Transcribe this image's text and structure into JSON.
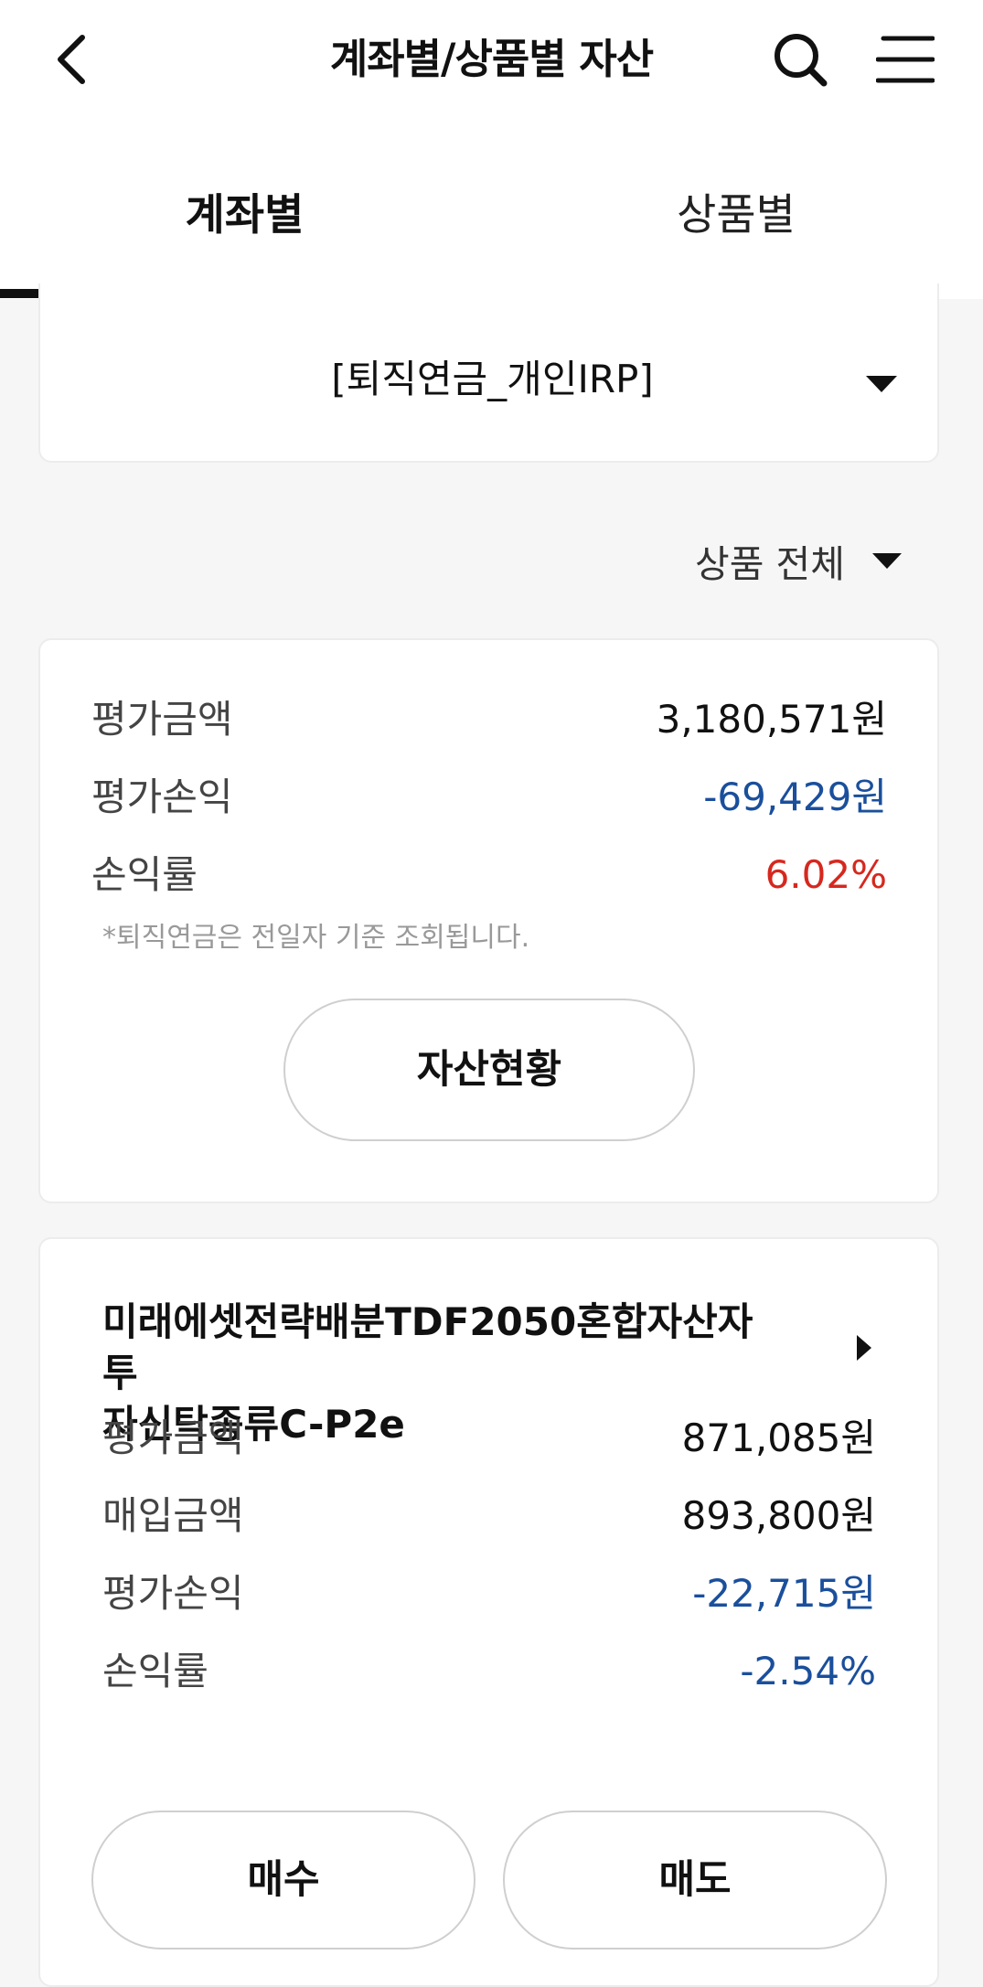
{
  "header": {
    "title": "계좌별/상품별 자산"
  },
  "tabs": [
    {
      "label": "계좌별",
      "active": true
    },
    {
      "label": "상품별",
      "active": false
    }
  ],
  "account": {
    "selected": "[퇴직연금_개인IRP]"
  },
  "filter": {
    "selected": "상품 전체"
  },
  "summary": {
    "rows": [
      {
        "label": "평가금액",
        "value": "3,180,571원"
      },
      {
        "label": "평가손익",
        "value": "-69,429원"
      },
      {
        "label": "손익률",
        "value": "6.02%"
      }
    ],
    "note": "*퇴직연금은 전일자 기준 조회됩니다.",
    "asset_button": "자산현황"
  },
  "product": {
    "name_line1": "미래에셋전략배분TDF2050혼합자산자투",
    "name_line2": "자신탁종류C-P2e",
    "rows": [
      {
        "label": "평가금액",
        "value": "871,085원"
      },
      {
        "label": "매입금액",
        "value": "893,800원"
      },
      {
        "label": "평가손익",
        "value": "-22,715원"
      },
      {
        "label": "손익률",
        "value": "-2.54%"
      }
    ],
    "buy_button": "매수",
    "sell_button": "매도"
  },
  "colors": {
    "negative": "#1a4f9c",
    "positive": "#d6281e",
    "tab_indicator": "#111111"
  }
}
